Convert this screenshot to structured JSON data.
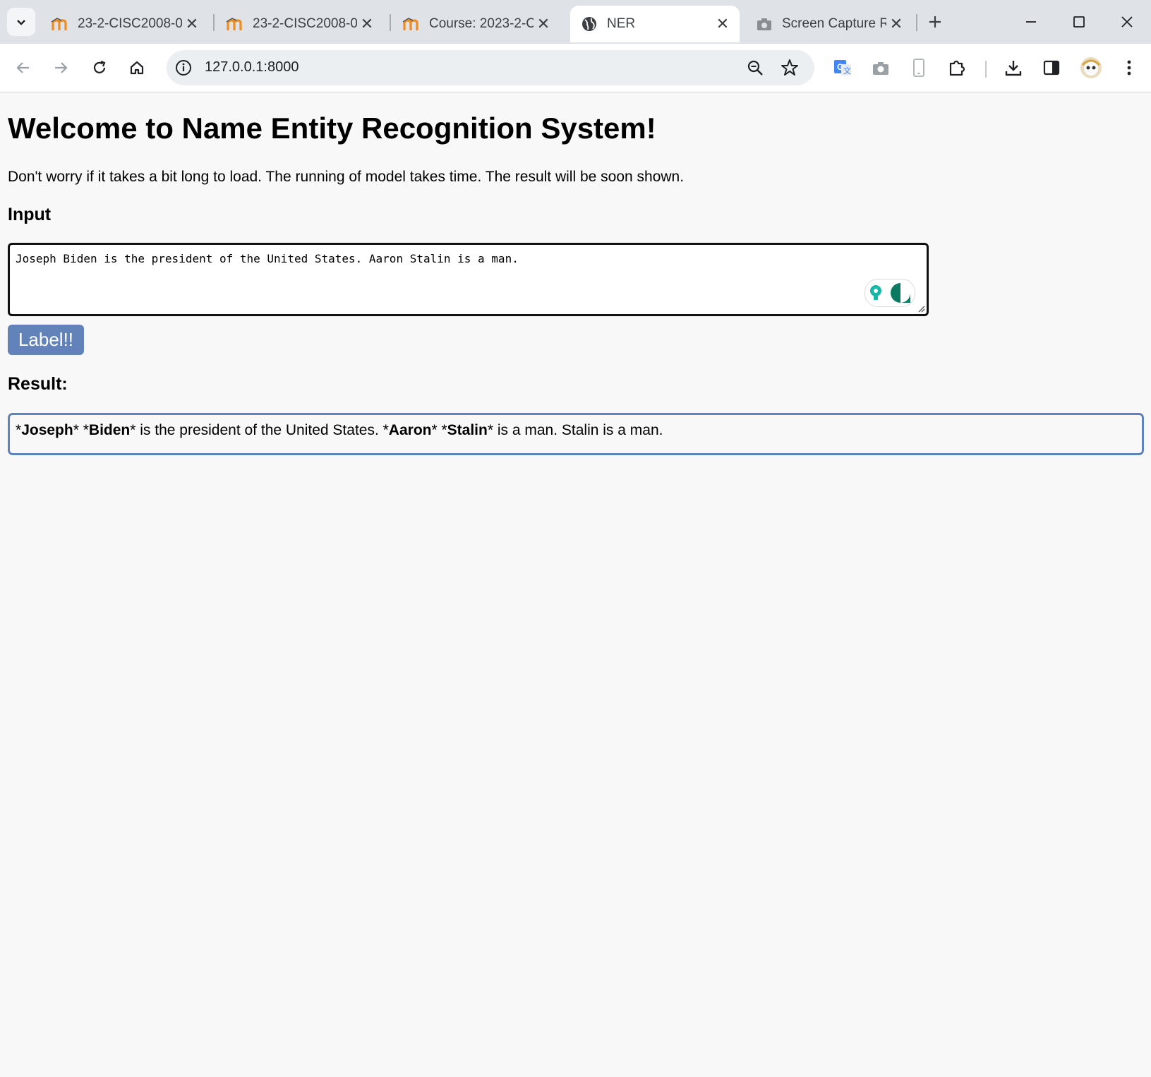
{
  "browser": {
    "tabs": [
      {
        "title": "23-2-CISC2008-00",
        "favicon": "moodle-icon",
        "active": false
      },
      {
        "title": "23-2-CISC2008-00",
        "favicon": "moodle-icon",
        "active": false
      },
      {
        "title": "Course: 2023-2-Cl",
        "favicon": "moodle-icon",
        "active": false
      },
      {
        "title": "NER",
        "favicon": "globe-icon",
        "active": true
      },
      {
        "title": "Screen Capture Re",
        "favicon": "camera-icon",
        "active": false
      }
    ],
    "address": "127.0.0.1:8000",
    "accent_color": "#6183b9"
  },
  "page": {
    "title": "Welcome to Name Entity Recognition System!",
    "notice": "Don't worry if it takes a bit long to load. The running of model takes time. The result will be soon shown.",
    "input_heading": "Input",
    "input_value": "Joseph Biden is the president of the United States. Aaron Stalin is a man.",
    "button_label": "Label!!",
    "result_heading": "Result:",
    "result_segments": [
      {
        "text": "*",
        "bold": false
      },
      {
        "text": "Joseph",
        "bold": true
      },
      {
        "text": "* *",
        "bold": false
      },
      {
        "text": "Biden",
        "bold": true
      },
      {
        "text": "* is the president of the United States. *",
        "bold": false
      },
      {
        "text": "Aaron",
        "bold": true
      },
      {
        "text": "* *",
        "bold": false
      },
      {
        "text": "Stalin",
        "bold": true
      },
      {
        "text": "* is a man. Stalin is a man.",
        "bold": false
      }
    ]
  }
}
